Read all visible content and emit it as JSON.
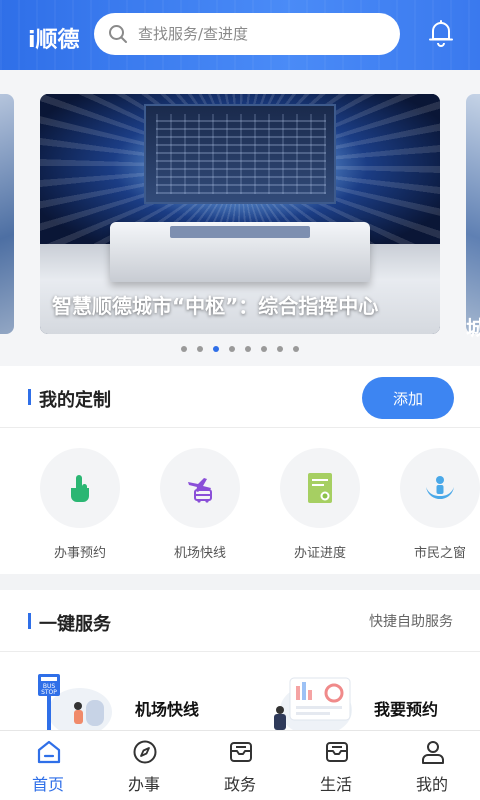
{
  "header": {
    "logo": "i顺德",
    "search_placeholder": "查找服务/查进度",
    "icons": [
      "search-icon",
      "bell-icon"
    ]
  },
  "carousel": {
    "caption": "智慧顺德城市“中枢”：综合指挥中心",
    "next_caption_fragment": "城",
    "dot_count": 8,
    "active_index": 2
  },
  "custom": {
    "title": "我的定制",
    "add_label": "添加",
    "items": [
      {
        "label": "办事预约",
        "icon": "hand-tap-icon",
        "color": "#2bb673"
      },
      {
        "label": "机场快线",
        "icon": "plane-bus-icon",
        "color": "#8a4fd8"
      },
      {
        "label": "办证进度",
        "icon": "certificate-icon",
        "color": "#8cc24a"
      },
      {
        "label": "市民之窗",
        "icon": "hands-person-icon",
        "color": "#4aa8e8"
      }
    ]
  },
  "oneclick": {
    "title": "一键服务",
    "link": "快捷自助服务",
    "items": [
      {
        "label": "机场快线",
        "icon": "bus-stop-icon",
        "sign_text": "BUS STOP"
      },
      {
        "label": "我要预约",
        "icon": "appointment-dashboard-icon"
      }
    ]
  },
  "nav": {
    "items": [
      {
        "label": "首页",
        "icon": "home-icon",
        "active": true
      },
      {
        "label": "办事",
        "icon": "compass-icon",
        "active": false
      },
      {
        "label": "政务",
        "icon": "tray-icon",
        "active": false
      },
      {
        "label": "生活",
        "icon": "tray-icon",
        "active": false
      },
      {
        "label": "我的",
        "icon": "user-icon",
        "active": false
      }
    ]
  },
  "colors": {
    "primary": "#2f6fe8",
    "button": "#3d85f2"
  }
}
